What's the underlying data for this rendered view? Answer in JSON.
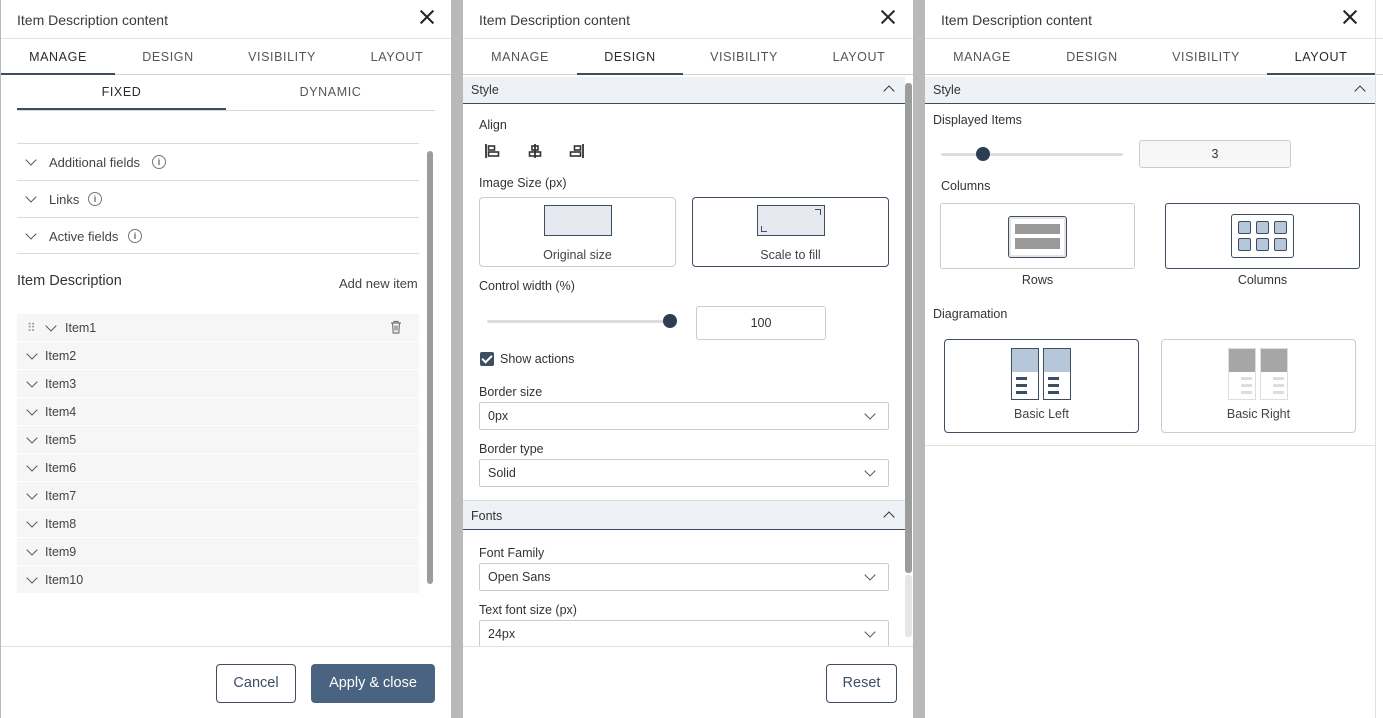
{
  "panel_manage": {
    "title": "Item Description content",
    "tabs": [
      "MANAGE",
      "DESIGN",
      "VISIBILITY",
      "LAYOUT"
    ],
    "active_tab": "MANAGE",
    "subtabs": [
      "FIXED",
      "DYNAMIC"
    ],
    "accordions": [
      "Additional fields",
      "Links",
      "Active fields"
    ],
    "section_title": "Item Description",
    "add_new": "Add new item",
    "items": [
      "Item1",
      "Item2",
      "Item3",
      "Item4",
      "Item5",
      "Item6",
      "Item7",
      "Item8",
      "Item9",
      "Item10"
    ],
    "cancel": "Cancel",
    "apply": "Apply & close"
  },
  "panel_design": {
    "title": "Item Description content",
    "tabs": [
      "MANAGE",
      "DESIGN",
      "VISIBILITY",
      "LAYOUT"
    ],
    "active_tab": "DESIGN",
    "style_header": "Style",
    "align_label": "Align",
    "image_size_label": "Image Size (px)",
    "image_options": [
      "Original size",
      "Scale to fill"
    ],
    "image_selected": "Scale to fill",
    "control_width_label": "Control width (%)",
    "control_width_value": "100",
    "control_width_fraction": 1.0,
    "show_actions": "Show actions",
    "show_actions_checked": true,
    "border_size_label": "Border size",
    "border_size_value": "0px",
    "border_type_label": "Border type",
    "border_type_value": "Solid",
    "fonts_header": "Fonts",
    "font_family_label": "Font Family",
    "font_family_value": "Open Sans",
    "text_font_size_label": "Text font size (px)",
    "text_font_size_value": "24px",
    "reset": "Reset"
  },
  "panel_layout": {
    "title": "Item Description content",
    "tabs": [
      "MANAGE",
      "DESIGN",
      "VISIBILITY",
      "LAYOUT"
    ],
    "active_tab": "LAYOUT",
    "style_header": "Style",
    "displayed_items_label": "Displayed Items",
    "displayed_items_value": "3",
    "displayed_items_fraction": 0.23,
    "columns_label": "Columns",
    "column_options": [
      "Rows",
      "Columns"
    ],
    "column_selected": "Columns",
    "diagramation_label": "Diagramation",
    "diagram_options": [
      "Basic Left",
      "Basic Right"
    ],
    "diagram_selected": "Basic Left"
  },
  "colors": {
    "accent": "#3d4d62",
    "primary_button": "#4a6380",
    "header_bg": "#eef1f5"
  }
}
